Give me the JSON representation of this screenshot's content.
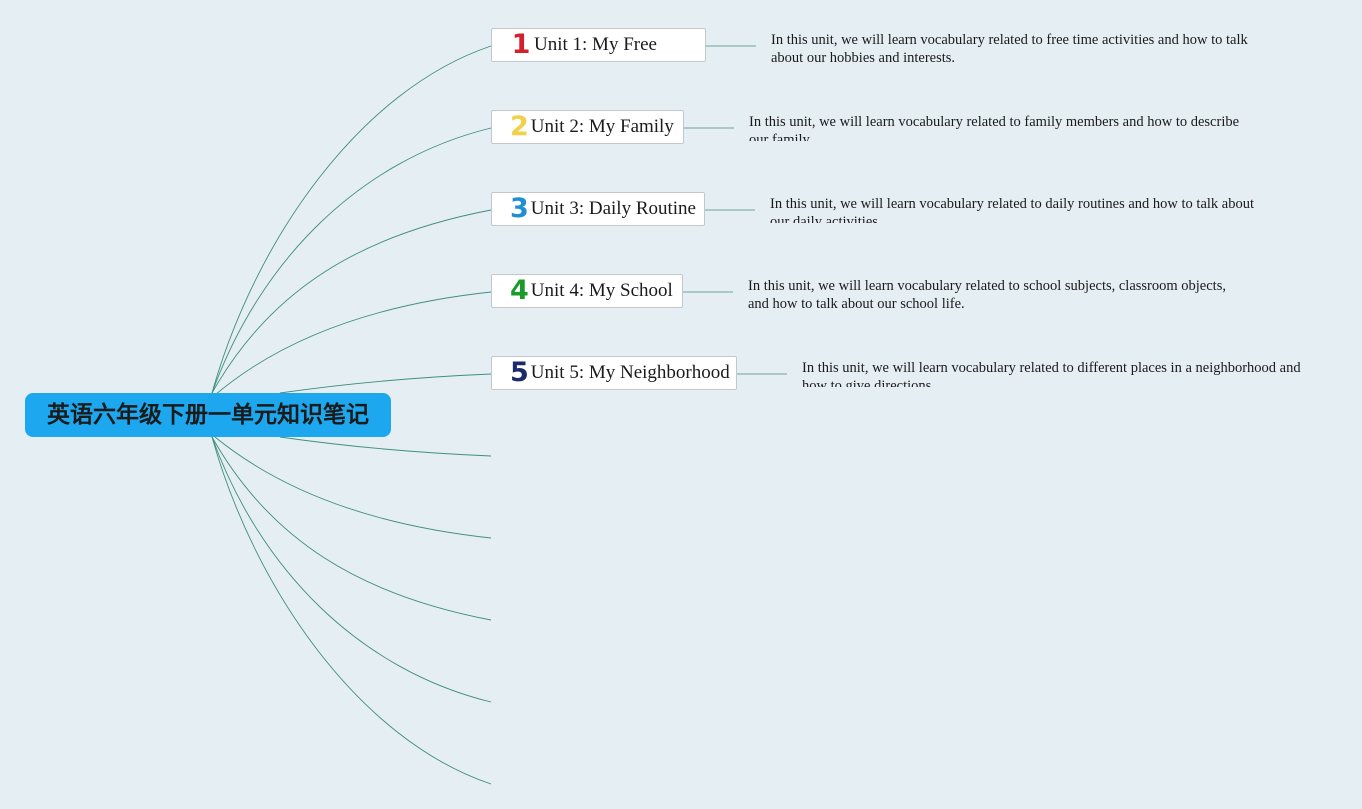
{
  "central_topic": "英语六年级下册一单元知识笔记",
  "colors": {
    "background": "#e5eef2",
    "central_fill": "#1da7ee",
    "connector": "#3f8f7d",
    "unit_1": "#d4202e",
    "unit_2": "#f2d04a",
    "unit_3": "#1e8fd6",
    "unit_4": "#1b9a2c",
    "unit_5": "#1b2a6b"
  },
  "units": [
    {
      "number": "1",
      "title": "Unit 1: My Free",
      "description": "In this unit, we will learn vocabulary related to free time activities and how to talk about our hobbies and interests."
    },
    {
      "number": "2",
      "title": "Unit 2: My Family",
      "description": "In this unit, we will learn vocabulary related to family members and how to describe our family."
    },
    {
      "number": "3",
      "title": "Unit 3: Daily Routine",
      "description": "In this unit, we will learn vocabulary related to daily routines and how to talk about our daily activities."
    },
    {
      "number": "4",
      "title": "Unit 4: My School",
      "description": "In this unit, we will learn vocabulary related to school subjects, classroom objects, and how to talk about our school life."
    },
    {
      "number": "5",
      "title": "Unit 5: My Neighborhood",
      "description": "In this unit, we will learn vocabulary related to different places in a neighborhood and how to give directions."
    }
  ]
}
